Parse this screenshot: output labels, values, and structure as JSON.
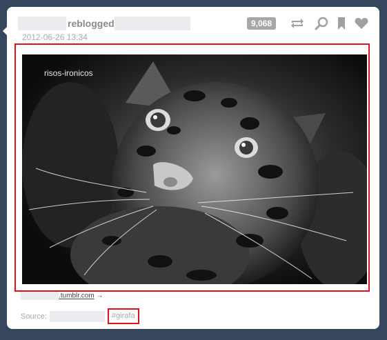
{
  "post": {
    "reblogged_text": "reblogged",
    "timestamp": "2012-06-26 13:34",
    "notes_count": "9,068",
    "watermark": "risos-ironicos",
    "source_url_suffix": ".tumblr.com",
    "source_arrow": "→",
    "source_label": "Source:",
    "tag": "#girafa"
  },
  "icons": [
    "reblog-icon",
    "search-icon",
    "bookmark-icon",
    "heart-icon"
  ],
  "colors": {
    "background": "#36465d",
    "highlight": "#e0101a",
    "notes_badge": "#a7a7a7"
  }
}
